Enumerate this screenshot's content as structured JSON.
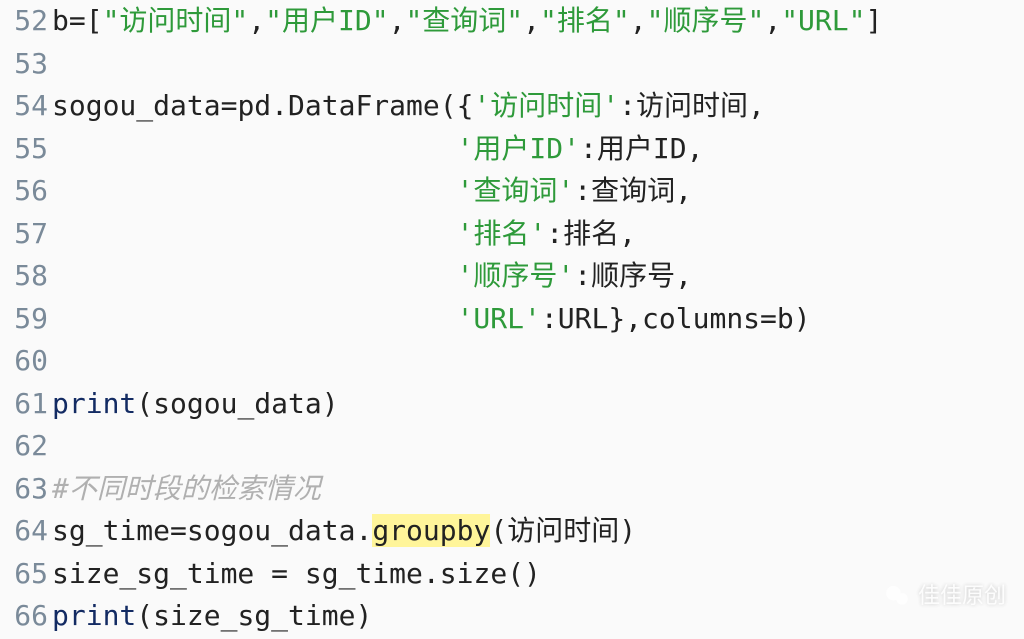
{
  "lines": [
    {
      "n": 52,
      "tokens": [
        {
          "t": "b",
          "c": "ident"
        },
        {
          "t": "=[",
          "c": "punct"
        },
        {
          "t": "\"访问时间\"",
          "c": "str"
        },
        {
          "t": ",",
          "c": "punct"
        },
        {
          "t": "\"用户ID\"",
          "c": "str"
        },
        {
          "t": ",",
          "c": "punct"
        },
        {
          "t": "\"查询词\"",
          "c": "str"
        },
        {
          "t": ",",
          "c": "punct"
        },
        {
          "t": "\"排名\"",
          "c": "str"
        },
        {
          "t": ",",
          "c": "punct"
        },
        {
          "t": "\"顺序号\"",
          "c": "str"
        },
        {
          "t": ",",
          "c": "punct"
        },
        {
          "t": "\"URL\"",
          "c": "str"
        },
        {
          "t": "]",
          "c": "punct"
        }
      ]
    },
    {
      "n": 53,
      "tokens": []
    },
    {
      "n": 54,
      "tokens": [
        {
          "t": "sogou_data",
          "c": "ident"
        },
        {
          "t": "=",
          "c": "punct"
        },
        {
          "t": "pd",
          "c": "ident"
        },
        {
          "t": ".",
          "c": "punct"
        },
        {
          "t": "DataFrame",
          "c": "ident"
        },
        {
          "t": "({",
          "c": "punct"
        },
        {
          "t": "'访问时间'",
          "c": "str"
        },
        {
          "t": ":",
          "c": "punct"
        },
        {
          "t": "访问时间",
          "c": "ident"
        },
        {
          "t": ",",
          "c": "punct"
        }
      ]
    },
    {
      "n": 55,
      "indent": 24,
      "tokens": [
        {
          "t": "'用户ID'",
          "c": "str"
        },
        {
          "t": ":",
          "c": "punct"
        },
        {
          "t": "用户ID",
          "c": "ident"
        },
        {
          "t": ",",
          "c": "punct"
        }
      ]
    },
    {
      "n": 56,
      "indent": 24,
      "tokens": [
        {
          "t": "'查询词'",
          "c": "str"
        },
        {
          "t": ":",
          "c": "punct"
        },
        {
          "t": "查询词",
          "c": "ident"
        },
        {
          "t": ",",
          "c": "punct"
        }
      ]
    },
    {
      "n": 57,
      "indent": 24,
      "tokens": [
        {
          "t": "'排名'",
          "c": "str"
        },
        {
          "t": ":",
          "c": "punct"
        },
        {
          "t": "排名",
          "c": "ident"
        },
        {
          "t": ",",
          "c": "punct"
        }
      ]
    },
    {
      "n": 58,
      "indent": 24,
      "tokens": [
        {
          "t": "'顺序号'",
          "c": "str"
        },
        {
          "t": ":",
          "c": "punct"
        },
        {
          "t": "顺序号",
          "c": "ident"
        },
        {
          "t": ",",
          "c": "punct"
        }
      ]
    },
    {
      "n": 59,
      "indent": 24,
      "tokens": [
        {
          "t": "'URL'",
          "c": "str"
        },
        {
          "t": ":",
          "c": "punct"
        },
        {
          "t": "URL",
          "c": "ident"
        },
        {
          "t": "},",
          "c": "punct"
        },
        {
          "t": "columns",
          "c": "ident"
        },
        {
          "t": "=",
          "c": "punct"
        },
        {
          "t": "b",
          "c": "ident"
        },
        {
          "t": ")",
          "c": "punct"
        }
      ]
    },
    {
      "n": 60,
      "tokens": []
    },
    {
      "n": 61,
      "tokens": [
        {
          "t": "print",
          "c": "print"
        },
        {
          "t": "(",
          "c": "punct"
        },
        {
          "t": "sogou_data",
          "c": "ident"
        },
        {
          "t": ")",
          "c": "punct"
        }
      ]
    },
    {
      "n": 62,
      "tokens": []
    },
    {
      "n": 63,
      "tokens": [
        {
          "t": "#不同时段的检索情况",
          "c": "comment"
        }
      ]
    },
    {
      "n": 64,
      "tokens": [
        {
          "t": "sg_time",
          "c": "ident"
        },
        {
          "t": "=",
          "c": "punct"
        },
        {
          "t": "sogou_data",
          "c": "ident"
        },
        {
          "t": ".",
          "c": "punct"
        },
        {
          "t": "groupby",
          "c": "ident",
          "hl": true
        },
        {
          "t": "(",
          "c": "punct"
        },
        {
          "t": "访问时间",
          "c": "ident"
        },
        {
          "t": ")",
          "c": "punct"
        }
      ]
    },
    {
      "n": 65,
      "tokens": [
        {
          "t": "size_sg_time",
          "c": "ident"
        },
        {
          "t": " = ",
          "c": "punct"
        },
        {
          "t": "sg_time",
          "c": "ident"
        },
        {
          "t": ".",
          "c": "punct"
        },
        {
          "t": "size",
          "c": "ident"
        },
        {
          "t": "()",
          "c": "punct"
        }
      ]
    },
    {
      "n": 66,
      "tokens": [
        {
          "t": "print",
          "c": "print"
        },
        {
          "t": "(",
          "c": "punct"
        },
        {
          "t": "size_sg_time",
          "c": "ident"
        },
        {
          "t": ")",
          "c": "punct"
        }
      ]
    }
  ],
  "watermark": {
    "label": "佳佳原创"
  }
}
